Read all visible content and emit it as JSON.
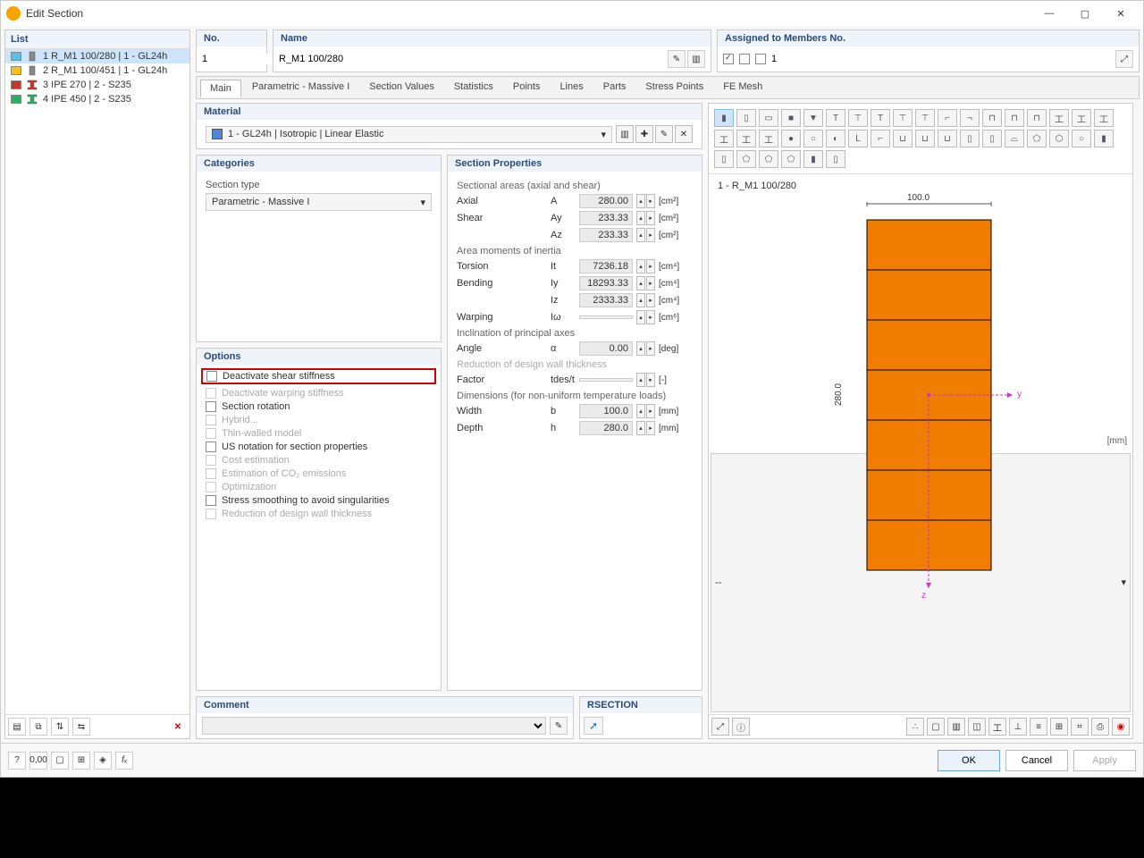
{
  "window": {
    "title": "Edit Section"
  },
  "sidebar": {
    "header": "List",
    "items": [
      {
        "idx": "1",
        "name": "R_M1 100/280 | 1 - GL24h",
        "color": "#5bbfea",
        "icon": "rect",
        "selected": true
      },
      {
        "idx": "2",
        "name": "R_M1 100/451 | 1 - GL24h",
        "color": "#f5c11f",
        "icon": "rect",
        "selected": false
      },
      {
        "idx": "3",
        "name": "IPE 270 | 2 - S235",
        "color": "#c0392b",
        "icon": "ibeam",
        "selected": false
      },
      {
        "idx": "4",
        "name": "IPE 450 | 2 - S235",
        "color": "#27ae60",
        "icon": "ibeam",
        "selected": false
      }
    ]
  },
  "header": {
    "no_label": "No.",
    "no_val": "1",
    "name_label": "Name",
    "name_val": "R_M1 100/280",
    "assigned_label": "Assigned to Members No.",
    "assigned_val": "1"
  },
  "tabs": [
    "Main",
    "Parametric - Massive I",
    "Section Values",
    "Statistics",
    "Points",
    "Lines",
    "Parts",
    "Stress Points",
    "FE Mesh"
  ],
  "material": {
    "header": "Material",
    "value": "1 - GL24h | Isotropic | Linear Elastic"
  },
  "categories": {
    "header": "Categories",
    "label": "Section type",
    "value": "Parametric - Massive I"
  },
  "options": {
    "header": "Options",
    "rows": [
      {
        "label": "Deactivate shear stiffness",
        "disabled": false,
        "highlight": true
      },
      {
        "label": "Deactivate warping stiffness",
        "disabled": true
      },
      {
        "label": "Section rotation",
        "disabled": false
      },
      {
        "label": "Hybrid...",
        "disabled": true
      },
      {
        "label": "Thin-walled model",
        "disabled": true
      },
      {
        "label": "US notation for section properties",
        "disabled": false
      },
      {
        "label": "Cost estimation",
        "disabled": true
      },
      {
        "label": "Estimation of CO₂ emissions",
        "disabled": true
      },
      {
        "label": "Optimization",
        "disabled": true
      },
      {
        "label": "Stress smoothing to avoid singularities",
        "disabled": false
      },
      {
        "label": "Reduction of design wall thickness",
        "disabled": true
      }
    ]
  },
  "props": {
    "header": "Section Properties",
    "groups": [
      {
        "title": "Sectional areas (axial and shear)",
        "rows": [
          {
            "name": "Axial",
            "sym": "A",
            "val": "280.00",
            "unit": "[cm²]"
          },
          {
            "name": "Shear",
            "sym": "Ay",
            "val": "233.33",
            "unit": "[cm²]"
          },
          {
            "name": "",
            "sym": "Az",
            "val": "233.33",
            "unit": "[cm²]"
          }
        ]
      },
      {
        "title": "Area moments of inertia",
        "rows": [
          {
            "name": "Torsion",
            "sym": "It",
            "val": "7236.18",
            "unit": "[cm⁴]"
          },
          {
            "name": "Bending",
            "sym": "Iy",
            "val": "18293.33",
            "unit": "[cm⁴]"
          },
          {
            "name": "",
            "sym": "Iz",
            "val": "2333.33",
            "unit": "[cm⁴]"
          },
          {
            "name": "Warping",
            "sym": "Iω",
            "val": "",
            "unit": "[cm⁶]",
            "disabled": true
          }
        ]
      },
      {
        "title": "Inclination of principal axes",
        "rows": [
          {
            "name": "Angle",
            "sym": "α",
            "val": "0.00",
            "unit": "[deg]"
          }
        ]
      },
      {
        "title": "Reduction of design wall thickness",
        "muted": true,
        "rows": [
          {
            "name": "Factor",
            "sym": "tdes/t",
            "val": "",
            "unit": "[-]",
            "disabled": true
          }
        ]
      },
      {
        "title": "Dimensions (for non-uniform temperature loads)",
        "rows": [
          {
            "name": "Width",
            "sym": "b",
            "val": "100.0",
            "unit": "[mm]"
          },
          {
            "name": "Depth",
            "sym": "h",
            "val": "280.0",
            "unit": "[mm]"
          }
        ]
      }
    ]
  },
  "preview": {
    "label": "1 - R_M1 100/280",
    "width_dim": "100.0",
    "height_dim": "280.0",
    "mm": "[mm]",
    "y": "y",
    "z": "z"
  },
  "comment": {
    "header": "Comment"
  },
  "rsection": {
    "header": "RSECTION"
  },
  "status": {
    "label": "--"
  },
  "footer": {
    "ok": "OK",
    "cancel": "Cancel",
    "apply": "Apply"
  }
}
